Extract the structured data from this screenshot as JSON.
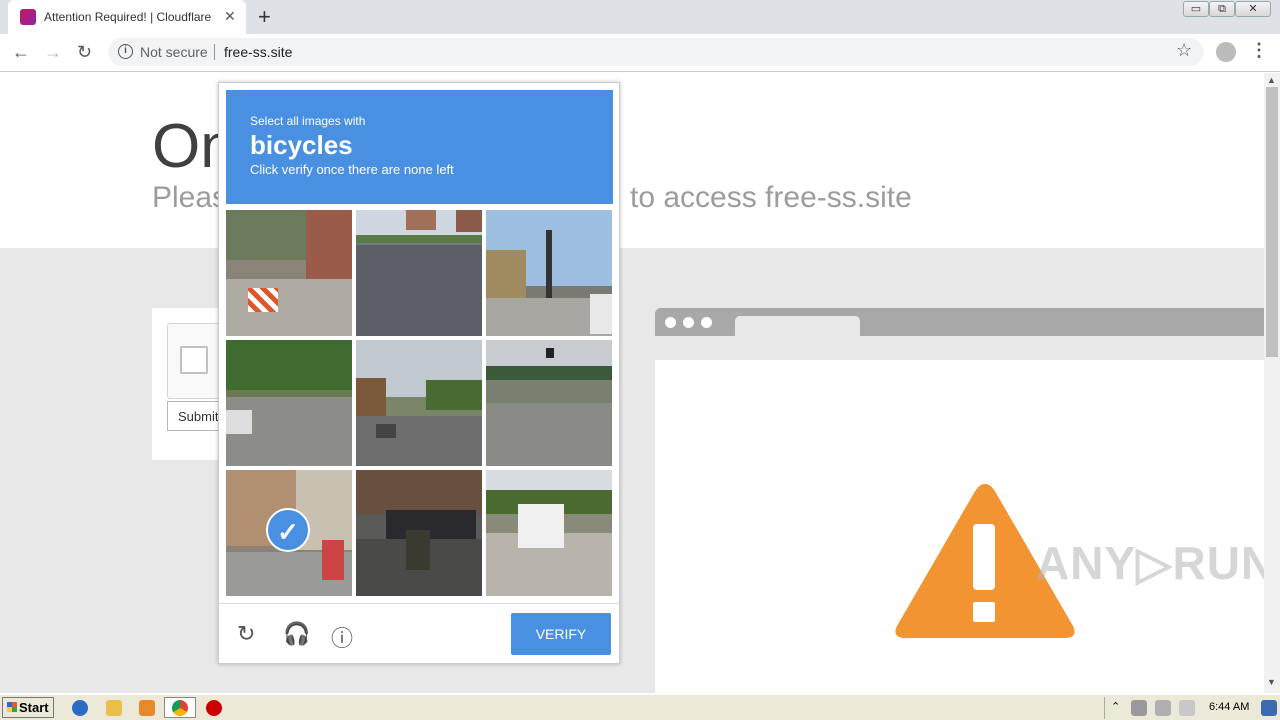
{
  "browser": {
    "tab_title": "Attention Required! | Cloudflare",
    "tab_close": "✕",
    "new_tab": "+",
    "window_buttons": [
      "▭",
      "⧉",
      "✕"
    ],
    "security_label": "Not secure",
    "url": "free-ss.site",
    "nav": {
      "back": "←",
      "forward": "→",
      "reload": "↻"
    },
    "star": "☆",
    "menu": "⋮"
  },
  "page": {
    "heading": "On",
    "subheading_left": "Pleas",
    "subheading_right": "to access free-ss.site",
    "submit_label": "Submit"
  },
  "captcha": {
    "instruction": "Select all images with",
    "keyword": "bicycles",
    "hint": "Click verify once there are none left",
    "tiles_selected": [
      false,
      false,
      false,
      false,
      false,
      false,
      true,
      false,
      false
    ],
    "check_mark": "✓",
    "verify_label": "VERIFY",
    "icons": {
      "reload": "↻",
      "audio": "🎧",
      "info": "ⓘ"
    }
  },
  "watermark": "ANY▷RUN",
  "taskbar": {
    "start_label": "Start",
    "clock": "6:44 AM"
  },
  "colors": {
    "captcha_blue": "#4a90e2",
    "warning_orange": "#f39433"
  }
}
